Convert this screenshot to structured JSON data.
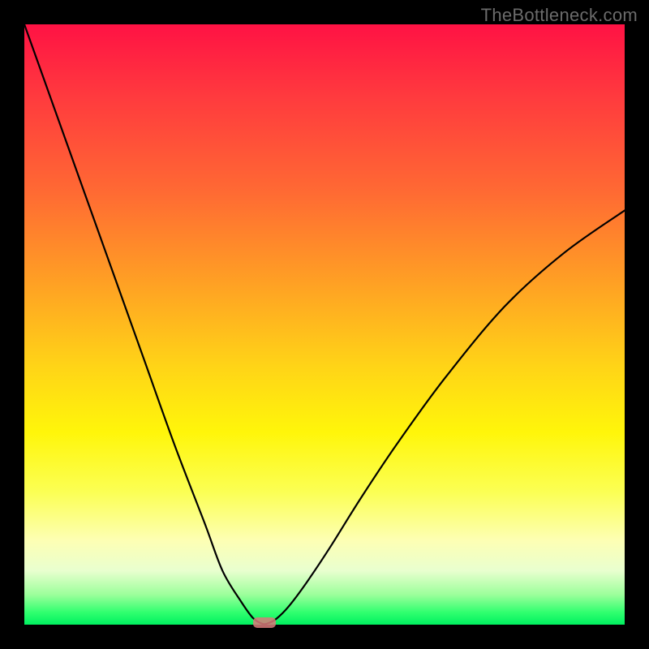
{
  "watermark": "TheBottleneck.com",
  "chart_data": {
    "type": "line",
    "title": "",
    "xlabel": "",
    "ylabel": "",
    "xlim": [
      0,
      100
    ],
    "ylim": [
      0,
      100
    ],
    "gradient_stops": [
      {
        "pos": 0,
        "color": "#ff1244"
      },
      {
        "pos": 12,
        "color": "#ff3a3e"
      },
      {
        "pos": 28,
        "color": "#ff6a33"
      },
      {
        "pos": 43,
        "color": "#ffa024"
      },
      {
        "pos": 57,
        "color": "#ffd417"
      },
      {
        "pos": 68,
        "color": "#fff60a"
      },
      {
        "pos": 78,
        "color": "#fbff55"
      },
      {
        "pos": 86,
        "color": "#fdffb4"
      },
      {
        "pos": 91,
        "color": "#e9ffcf"
      },
      {
        "pos": 95,
        "color": "#9cff9b"
      },
      {
        "pos": 98,
        "color": "#2fff6e"
      },
      {
        "pos": 100,
        "color": "#00f060"
      }
    ],
    "series": [
      {
        "name": "bottleneck-curve",
        "x": [
          0,
          5,
          10,
          15,
          20,
          25,
          30,
          33,
          36,
          38,
          39.5,
          40.5,
          42,
          44,
          47,
          51,
          56,
          62,
          70,
          80,
          90,
          100
        ],
        "y": [
          100,
          86,
          72,
          58,
          44,
          30,
          17,
          9,
          4,
          1.2,
          0.2,
          0.2,
          1,
          3,
          7,
          13,
          21,
          30,
          41,
          53,
          62,
          69
        ]
      }
    ],
    "vertex_x": 40,
    "marker": {
      "x": 40,
      "y": 0,
      "color": "#d97a7a"
    }
  }
}
